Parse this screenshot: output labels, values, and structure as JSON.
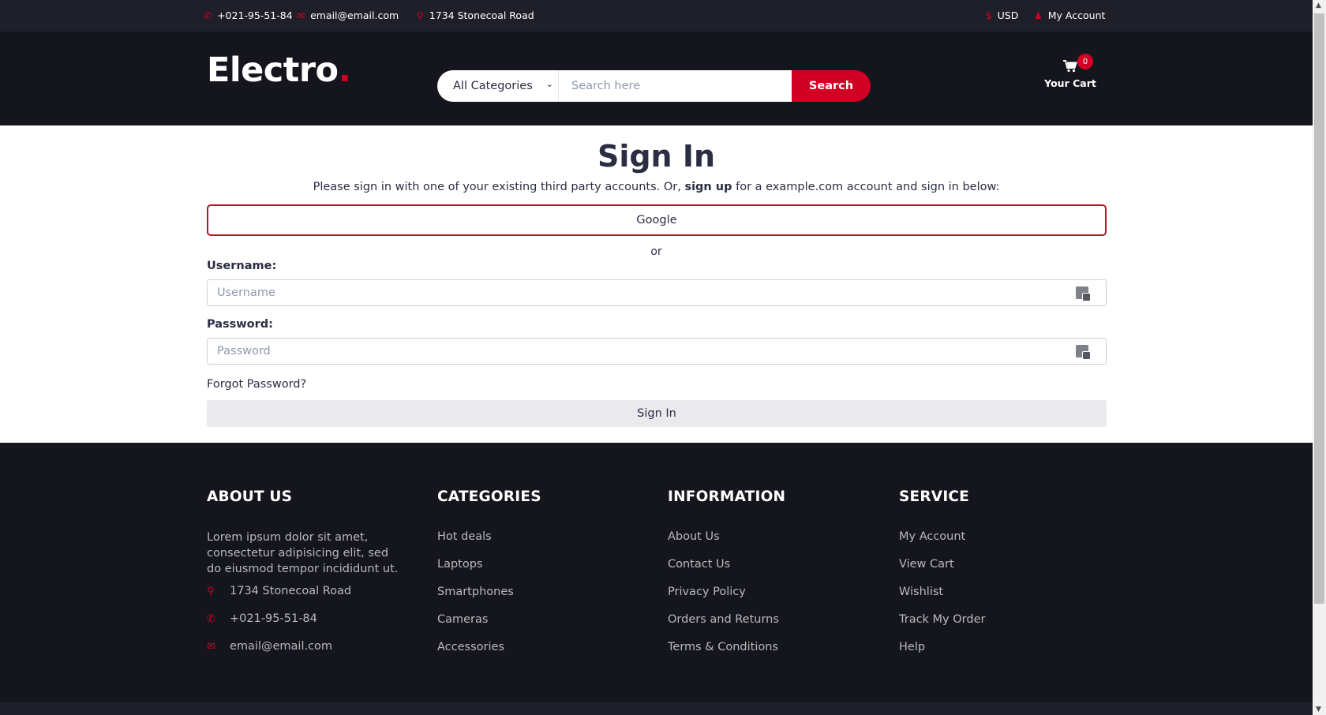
{
  "topbar": {
    "phone": "+021-95-51-84",
    "email": "email@email.com",
    "address": "1734 Stonecoal Road",
    "currency": "USD",
    "account": "My Account",
    "phone_icon": "phone-icon",
    "email_icon": "envelope-icon",
    "address_icon": "map-marker-icon",
    "currency_icon": "dollar-icon",
    "account_icon": "user-icon"
  },
  "header": {
    "logo_text": "Electro",
    "logo_dot": ".",
    "search": {
      "category_selected": "All Categories",
      "placeholder": "Search here",
      "button_label": "Search"
    },
    "cart": {
      "label": "Your Cart",
      "count": "0",
      "icon": "shopping-cart-icon"
    }
  },
  "signin": {
    "title": "Sign In",
    "intro_before": "Please sign in with one of your existing third party accounts. Or, ",
    "intro_link": "sign up",
    "intro_after": " for a example.com account and sign in below:",
    "google_label": "Google",
    "or_text": "or",
    "username_label": "Username:",
    "username_placeholder": "Username",
    "password_label": "Password:",
    "password_placeholder": "Password",
    "forgot_label": "Forgot Password?",
    "submit_label": "Sign In"
  },
  "footer": {
    "about": {
      "title": "ABOUT US",
      "text": "Lorem ipsum dolor sit amet, consectetur adipisicing elit, sed do eiusmod tempor incididunt ut.",
      "address": "1734 Stonecoal Road",
      "phone": "+021-95-51-84",
      "email": "email@email.com"
    },
    "categories": {
      "title": "CATEGORIES",
      "items": [
        "Hot deals",
        "Laptops",
        "Smartphones",
        "Cameras",
        "Accessories"
      ]
    },
    "information": {
      "title": "INFORMATION",
      "items": [
        "About Us",
        "Contact Us",
        "Privacy Policy",
        "Orders and Returns",
        "Terms & Conditions"
      ]
    },
    "service": {
      "title": "SERVICE",
      "items": [
        "My Account",
        "View Cart",
        "Wishlist",
        "Track My Order",
        "Help"
      ]
    }
  },
  "colors": {
    "accent": "#d10024",
    "header_bg": "#15161d",
    "topbar_bg": "#1e1f29"
  }
}
